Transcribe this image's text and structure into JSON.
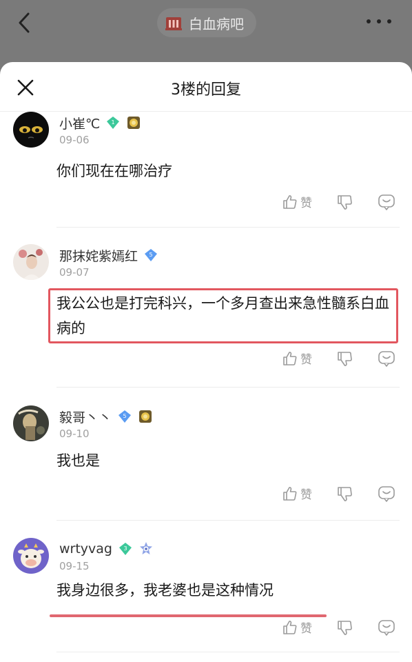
{
  "topbar": {
    "forum_name": "白血病吧"
  },
  "sheet": {
    "title": "3楼的回复"
  },
  "actions": {
    "like_label": "赞"
  },
  "comments": [
    {
      "username": "小崔℃",
      "level": "1",
      "date": "09-06",
      "text": "你们现在在哪治疗"
    },
    {
      "username": "那抹姹紫嫣红",
      "level": "5",
      "date": "09-07",
      "text": "我公公也是打完科兴，一个多月查出来急性髓系白血病的"
    },
    {
      "username": "毅哥丶丶",
      "level": "5",
      "date": "09-10",
      "text": "我也是"
    },
    {
      "username": "wrtyvag",
      "level": "3",
      "date": "09-15",
      "text": "我身边很多，我老婆也是这种情况"
    }
  ],
  "colors": {
    "annotation": "#e2575f",
    "badge_green": "#3cc89a",
    "badge_blue": "#5b9cf2"
  }
}
